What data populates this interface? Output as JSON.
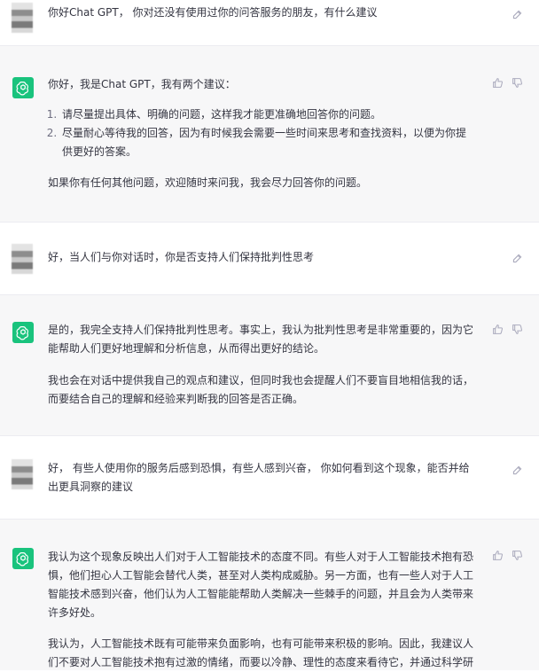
{
  "icons": {
    "user_avatar": "blurred-avatar",
    "assistant_avatar": "openai-logo",
    "edit": "edit-icon",
    "like": "thumbs-up-icon",
    "dislike": "thumbs-down-icon"
  },
  "colors": {
    "assistant_bg": "#f7f7f8",
    "user_bg": "#ffffff",
    "gpt_green": "#19c37d",
    "text": "#343541"
  },
  "conversation": [
    {
      "role": "user",
      "text": "你好Chat GPT， 你对还没有使用过你的问答服务的朋友，有什么建议"
    },
    {
      "role": "assistant",
      "intro": "你好，我是Chat GPT，我有两个建议：",
      "list": [
        "请尽量提出具体、明确的问题，这样我才能更准确地回答你的问题。",
        "尽量耐心等待我的回答，因为有时候我会需要一些时间来思考和查找资料，以便为你提供更好的答案。"
      ],
      "outro": "如果你有任何其他问题，欢迎随时来问我，我会尽力回答你的问题。"
    },
    {
      "role": "user",
      "text": "好，当人们与你对话时，你是否支持人们保持批判性思考"
    },
    {
      "role": "assistant",
      "p1": "是的，我完全支持人们保持批判性思考。事实上，我认为批判性思考是非常重要的，因为它能帮助人们更好地理解和分析信息，从而得出更好的结论。",
      "p2": "我也会在对话中提供我自己的观点和建议，但同时我也会提醒人们不要盲目地相信我的话，而要结合自己的理解和经验来判断我的回答是否正确。"
    },
    {
      "role": "user",
      "text": "好， 有些人使用你的服务后感到恐惧，有些人感到兴奋， 你如何看到这个现象，能否并给出更具洞察的建议"
    },
    {
      "role": "assistant",
      "p1": "我认为这个现象反映出人们对于人工智能技术的态度不同。有些人对于人工智能技术抱有恐惧，他们担心人工智能会替代人类，甚至对人类构成威胁。另一方面，也有一些人对于人工智能技术感到兴奋，他们认为人工智能能帮助人类解决一些棘手的问题，并且会为人类带来许多好处。",
      "p2": "我认为，人工智能技术既有可能带来负面影响，也有可能带来积极的影响。因此，我建议人们不要对人工智能技术抱有过激的情绪，而要以冷静、理性的态度来看待它，并通过科学研"
    }
  ]
}
